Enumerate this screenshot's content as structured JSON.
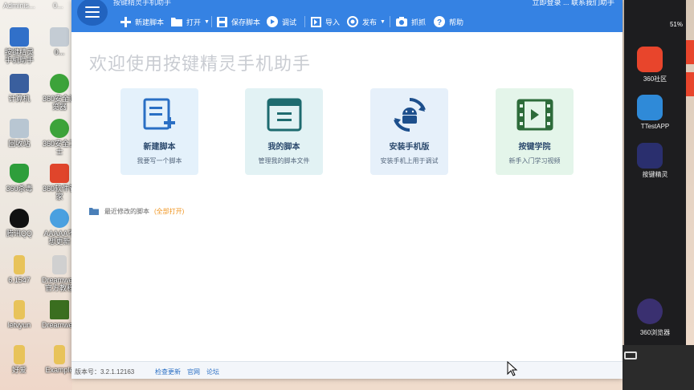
{
  "desktop": {
    "top_text_left": "Adminis...",
    "top_text_right": "0...",
    "icons": [
      {
        "label": "按键精灵手机助手",
        "icon": "phone-assistant-icon",
        "color": "#3170c9"
      },
      {
        "label": "0...",
        "icon": "file-icon",
        "color": "#9aa6b2"
      },
      {
        "label": "计算机",
        "icon": "computer-icon",
        "color": "#3a5f9e"
      },
      {
        "label": "360安全浏览器",
        "icon": "browser-360-icon",
        "color": "#3ca33a"
      },
      {
        "label": "回收站",
        "icon": "recycle-bin-icon",
        "color": "#9aaebf"
      },
      {
        "label": "360安全卫士",
        "icon": "security-360-icon",
        "color": "#3ca33a"
      },
      {
        "label": "360杀毒",
        "icon": "antivirus-360-icon",
        "color": "#2e9e3b"
      },
      {
        "label": "360软件管家",
        "icon": "software-manager-icon",
        "color": "#e0452b"
      },
      {
        "label": "腾讯QQ",
        "icon": "qq-icon",
        "color": "#111111"
      },
      {
        "label": "AAAAA不想更新",
        "icon": "aaaa-icon",
        "color": "#4aa0e0"
      },
      {
        "label": "6.1547",
        "icon": "folder-icon",
        "color": "#e8c35a"
      },
      {
        "label": "Dreamwea...官方教程",
        "icon": "dreamweaver-doc-icon",
        "color": "#c8c8c8"
      },
      {
        "label": "letvyun",
        "icon": "folder-icon",
        "color": "#e8c35a"
      },
      {
        "label": "Dreamwe...",
        "icon": "dreamweaver-icon",
        "color": "#3a6e1f"
      },
      {
        "label": "好爱",
        "icon": "folder-icon",
        "color": "#e8c35a"
      },
      {
        "label": "Example",
        "icon": "folder-icon",
        "color": "#e8c35a"
      }
    ]
  },
  "window": {
    "title": "按键精灵手机助手",
    "toolbar": {
      "new_script": "新建脚本",
      "open": "打开",
      "save_script": "保存脚本",
      "debug": "调试",
      "import": "导入",
      "publish": "发布",
      "capture": "抓抓",
      "help": "帮助",
      "right_text": "立即登录 ... 联系我们助手"
    },
    "welcome_title": "欢迎使用按键精灵手机助手",
    "cards": [
      {
        "title": "新建脚本",
        "subtitle": "我要写一个脚本"
      },
      {
        "title": "我的脚本",
        "subtitle": "管理我的脚本文件"
      },
      {
        "title": "安装手机版",
        "subtitle": "安装手机上用于调试"
      },
      {
        "title": "按键学院",
        "subtitle": "新手入门学习视频"
      }
    ],
    "recent": {
      "label": "最近修改的脚本",
      "open_all": "(全部打开)"
    },
    "status": {
      "version": "版本号：3.2.1.12163",
      "check_update": "检查更新",
      "website": "官网",
      "forum": "论坛"
    }
  },
  "phone": {
    "status": "51%",
    "apps": [
      {
        "label": "360社区",
        "icon": "community-360-icon",
        "color": "#e8452c"
      },
      {
        "label": "TTestAPP",
        "icon": "ttestapp-icon",
        "color": "#2f8ad8"
      },
      {
        "label": "按键精灵",
        "icon": "keyboard-wizard-icon",
        "color": "#2a2f6e"
      },
      {
        "label": "360浏览器",
        "icon": "browser-360-phone-icon",
        "color": "#3a3070"
      }
    ]
  },
  "colors": {
    "toolbar_blue": "#3582e3",
    "accent_orange": "#f09520"
  }
}
